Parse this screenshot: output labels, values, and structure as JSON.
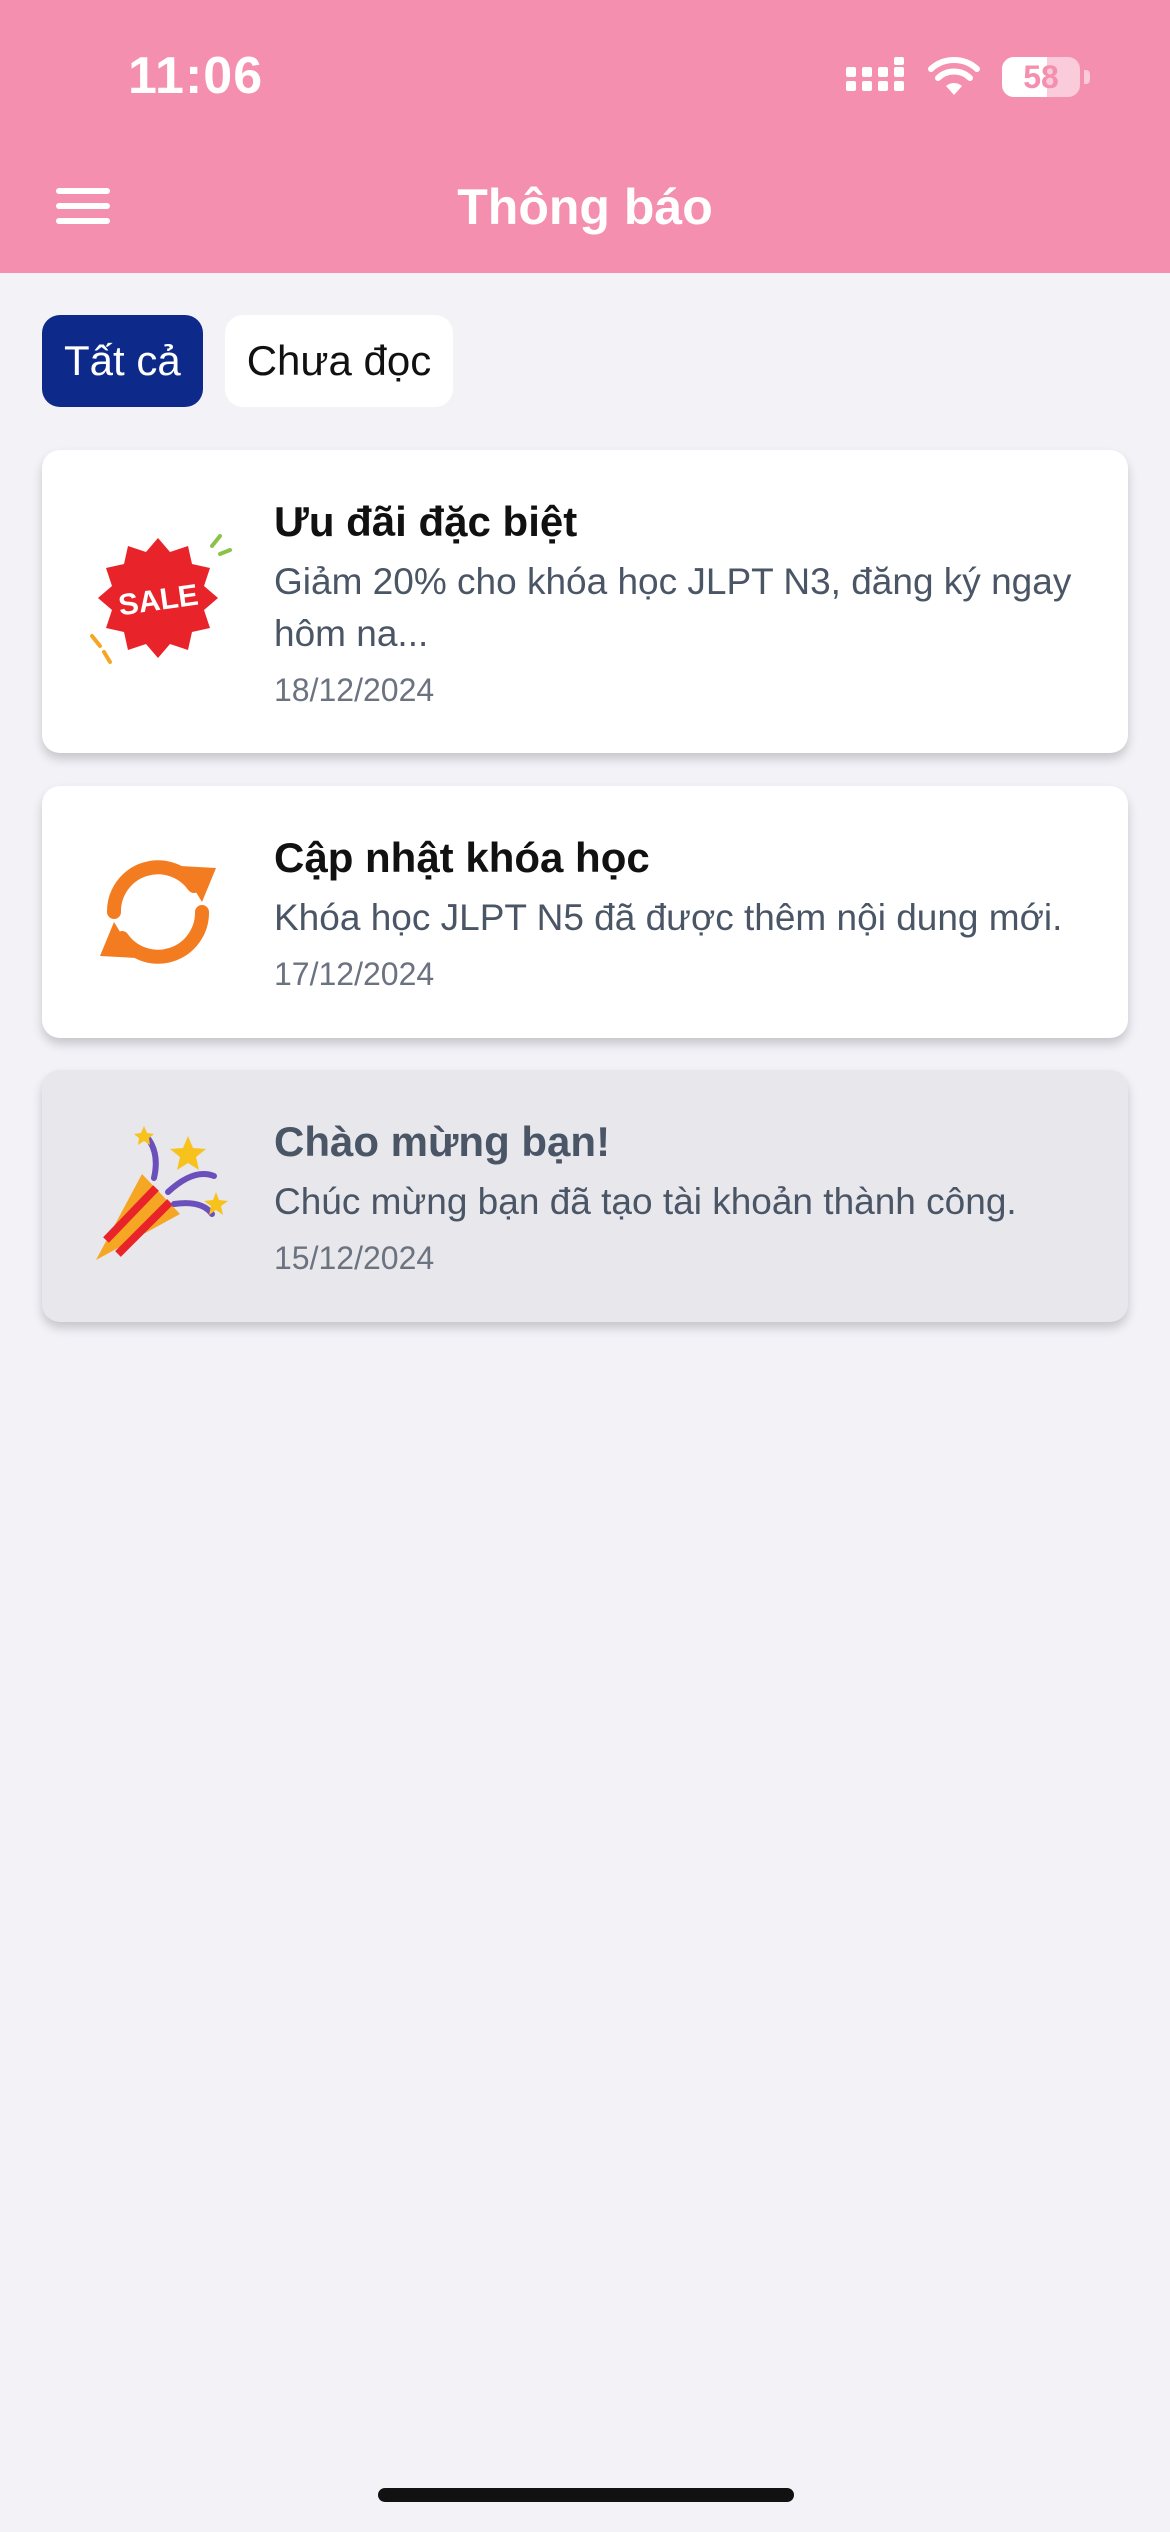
{
  "status_bar": {
    "time": "11:06",
    "battery": "58",
    "battery_level": 0.58,
    "signal_icon": "cellular-signal-icon",
    "wifi_icon": "wifi-icon"
  },
  "header": {
    "title": "Thông báo",
    "menu_icon": "hamburger-menu-icon",
    "background_color": "#f48fb0"
  },
  "tabs": [
    {
      "label": "Tất cả",
      "active": true
    },
    {
      "label": "Chưa đọc",
      "active": false
    }
  ],
  "notifications": [
    {
      "title": "Ưu đãi đặc biệt",
      "body": "Giảm 20% cho khóa học JLPT N3, đăng ký ngay hôm na...",
      "date": "18/12/2024",
      "icon": "sale-badge-icon",
      "read": false
    },
    {
      "title": "Cập nhật khóa học",
      "body": "Khóa học JLPT N5 đã được thêm nội dung mới.",
      "date": "17/12/2024",
      "icon": "refresh-arrows-icon",
      "read": false
    },
    {
      "title": "Chào mừng bạn!",
      "body": "Chúc mừng bạn đã tạo tài khoản thành công.",
      "date": "15/12/2024",
      "icon": "party-popper-icon",
      "read": true
    }
  ],
  "colors": {
    "accent": "#0d2a8a",
    "header": "#f48fb0",
    "background": "#f2f2f7",
    "read_card": "#e7e7ec"
  }
}
